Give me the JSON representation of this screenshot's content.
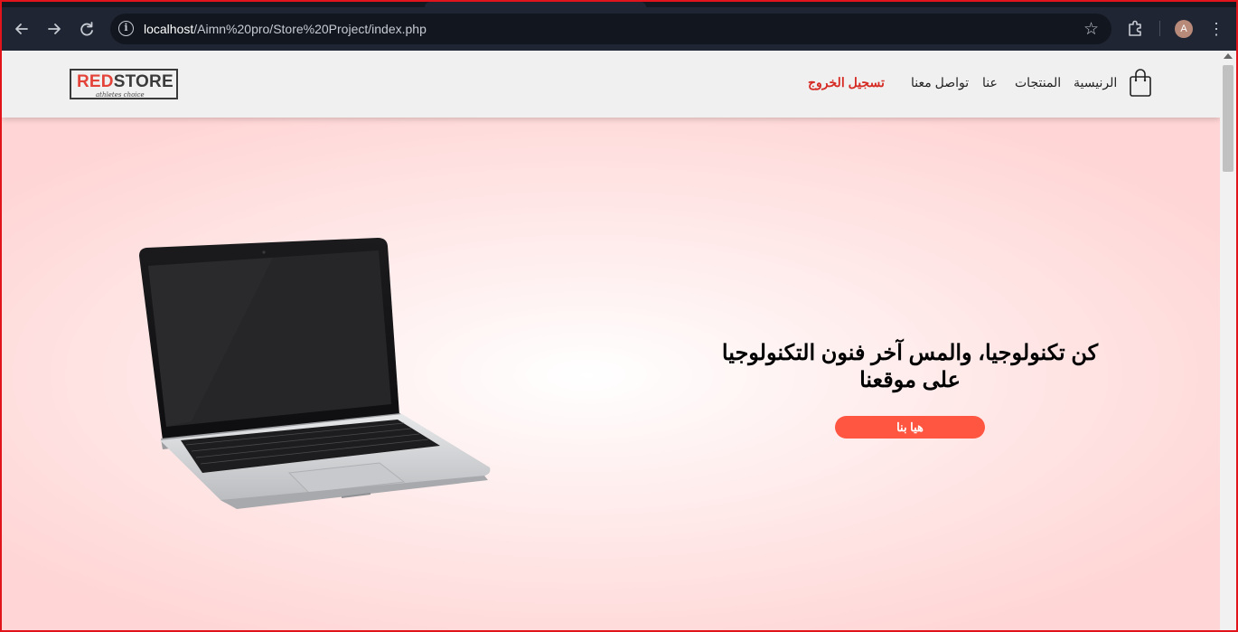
{
  "browser": {
    "url_host": "localhost",
    "url_path": "/Aimn%20pro/Store%20Project/index.php",
    "profile_initial": "A",
    "icons": [
      "back-arrow-icon",
      "forward-arrow-icon",
      "reload-icon",
      "site-info-icon",
      "bookmark-star-icon",
      "extensions-puzzle-icon",
      "more-menu-icon"
    ]
  },
  "header": {
    "logo_red": "RED",
    "logo_rest": "STORE",
    "logo_tagline": "athletes choice",
    "nav": {
      "home": "الرنيسية",
      "products": "المنتجات",
      "about": "عنا",
      "contact": "تواصل معنا",
      "logout": "تسجيل الخروج"
    },
    "cart_icon": "shopping-bag-icon"
  },
  "hero": {
    "title_line1": "كن تكنولوجيا، والمس آخر فنون التكنولوجيا",
    "title_line2": "على موقعنا",
    "button_label": "هيا بنا",
    "image": "laptop-image"
  },
  "colors": {
    "accent": "#ff5641",
    "logout_text": "#d62b24",
    "browser_chrome": "#1f2532",
    "page_tint": "#ffd5d5"
  }
}
